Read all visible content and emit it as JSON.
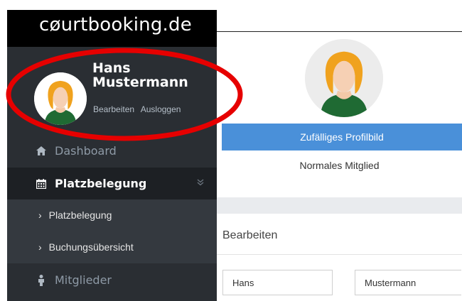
{
  "app": {
    "logo": "cøurtbooking.de"
  },
  "profile": {
    "first_name": "Hans",
    "last_name": "Mustermann",
    "edit_link": "Bearbeiten",
    "logout_link": "Ausloggen"
  },
  "menu": {
    "dashboard": "Dashboard",
    "platzbelegung": "Platzbelegung",
    "sub": [
      "Platzbelegung",
      "Buchungsübersicht"
    ],
    "mitglieder": "Mitglieder"
  },
  "main": {
    "random_button": "Zufälliges Profilbild",
    "member_type": "Normales Mitglied",
    "edit_title": "Bearbeiten",
    "first_name_value": "Hans",
    "last_name_value": "Mustermann"
  },
  "colors": {
    "sidebar_bg": "#2a2e33",
    "active_bg": "#1d2024",
    "submenu_bg": "#34393f",
    "button_blue": "#4a90d9",
    "annotation_red": "#e60000"
  },
  "icons": [
    "home-icon",
    "calendar-icon",
    "chevron-down-icon",
    "person-icon",
    "chevron-right-icon"
  ]
}
